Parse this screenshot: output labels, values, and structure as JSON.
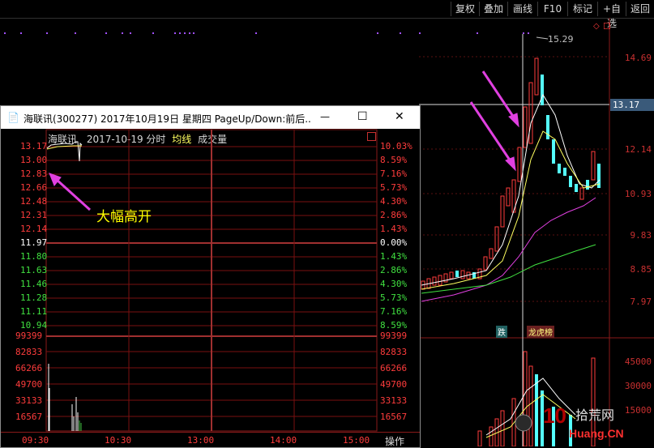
{
  "toolbar": {
    "buttons": [
      "复权",
      "叠加",
      "画线",
      "F10",
      "标记",
      "+自选",
      "返回"
    ]
  },
  "main_chart": {
    "price_ticks": [
      "14.69",
      "13.17",
      "12.14",
      "10.93",
      "9.83",
      "8.85",
      "7.97"
    ],
    "current_price_label": "13.17",
    "high_label": "15.29",
    "volume_ticks": [
      "45000",
      "30000",
      "15000"
    ],
    "event_tags": [
      "跌",
      "龙虎榜"
    ]
  },
  "window": {
    "title": "海联讯(300277) 2017年10月19日 星期四 PageUp/Down:前后...",
    "controls": {
      "minimize": "—",
      "maximize": "☐",
      "close": "✕"
    },
    "header": {
      "name": "海联讯",
      "date": "2017-10-19",
      "mode": "分时",
      "avg_label": "均线",
      "vol_label": "成交量"
    },
    "left_prices": [
      "13.17",
      "13.00",
      "12.83",
      "12.66",
      "12.48",
      "12.31",
      "12.14",
      "11.97",
      "11.80",
      "11.63",
      "11.46",
      "11.28",
      "11.11",
      "10.94"
    ],
    "right_pcts": [
      "10.03%",
      "8.59%",
      "7.16%",
      "5.73%",
      "4.30%",
      "2.86%",
      "1.43%",
      "0.00%",
      "1.43%",
      "2.86%",
      "4.30%",
      "5.73%",
      "7.16%",
      "8.59%"
    ],
    "volume_ticks": [
      "99399",
      "82833",
      "66266",
      "49700",
      "33133",
      "16567"
    ],
    "time_ticks": [
      "09:30",
      "10:30",
      "13:00",
      "14:00",
      "15:00"
    ],
    "ops_label": "操作",
    "annotation": "大幅高开"
  },
  "colors": {
    "up": "#ff3c3c",
    "down": "#54ffff",
    "flat": "#ffffff",
    "grid": "#7a1010",
    "annotation": "#ffff00",
    "arrow": "#e040e0"
  },
  "watermark": "拾荒网 10 Huang.CN"
}
